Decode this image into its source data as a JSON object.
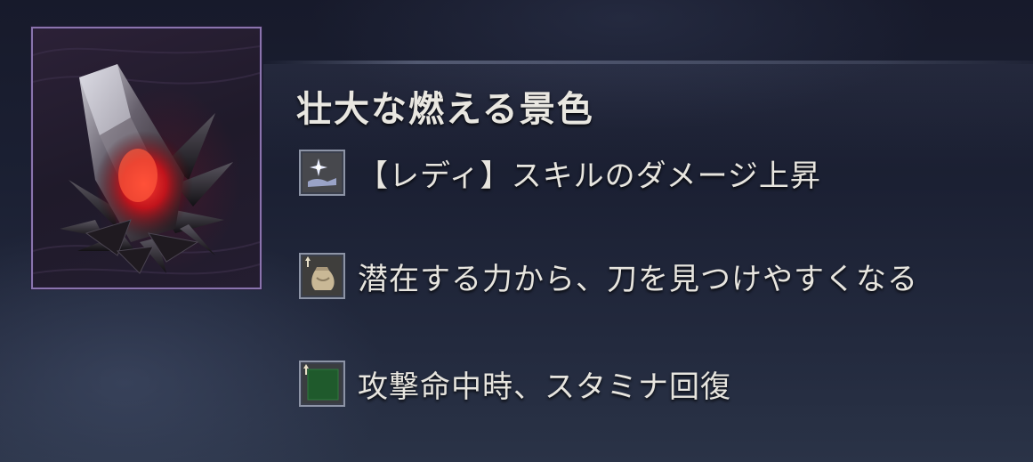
{
  "item": {
    "name": "壮大な燃える景色",
    "icon": "red-crystal-icon",
    "rarity_color": "#8a74ad"
  },
  "effects": [
    {
      "icon": "skill-damage-icon",
      "text": "【レディ】スキルのダメージ上昇"
    },
    {
      "icon": "pouch-up-icon",
      "text": "潜在する力から、刀を見つけやすくなる"
    },
    {
      "icon": "stamina-up-icon",
      "text": "攻撃命中時、スタミナ回復"
    }
  ]
}
